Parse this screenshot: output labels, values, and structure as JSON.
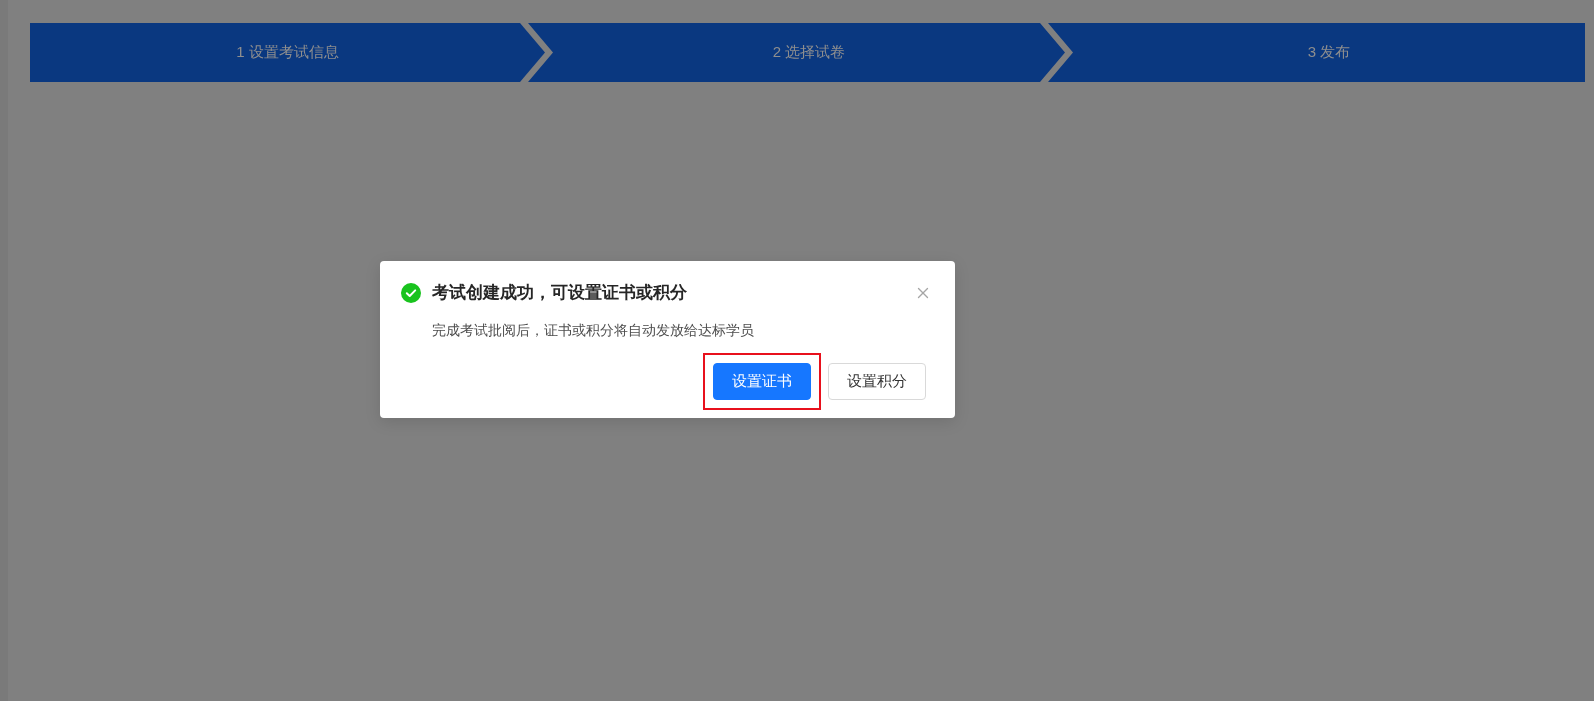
{
  "steps": [
    {
      "label": "1 设置考试信息"
    },
    {
      "label": "2 选择试卷"
    },
    {
      "label": "3 发布"
    }
  ],
  "dialog": {
    "kind": "success",
    "title": "考试创建成功，可设置证书或积分",
    "message": "完成考试批阅后，证书或积分将自动发放给达标学员",
    "buttons": [
      {
        "label": "设置证书",
        "kind": "primary",
        "highlighted": true
      },
      {
        "label": "设置积分",
        "kind": "default",
        "highlighted": false
      }
    ]
  }
}
